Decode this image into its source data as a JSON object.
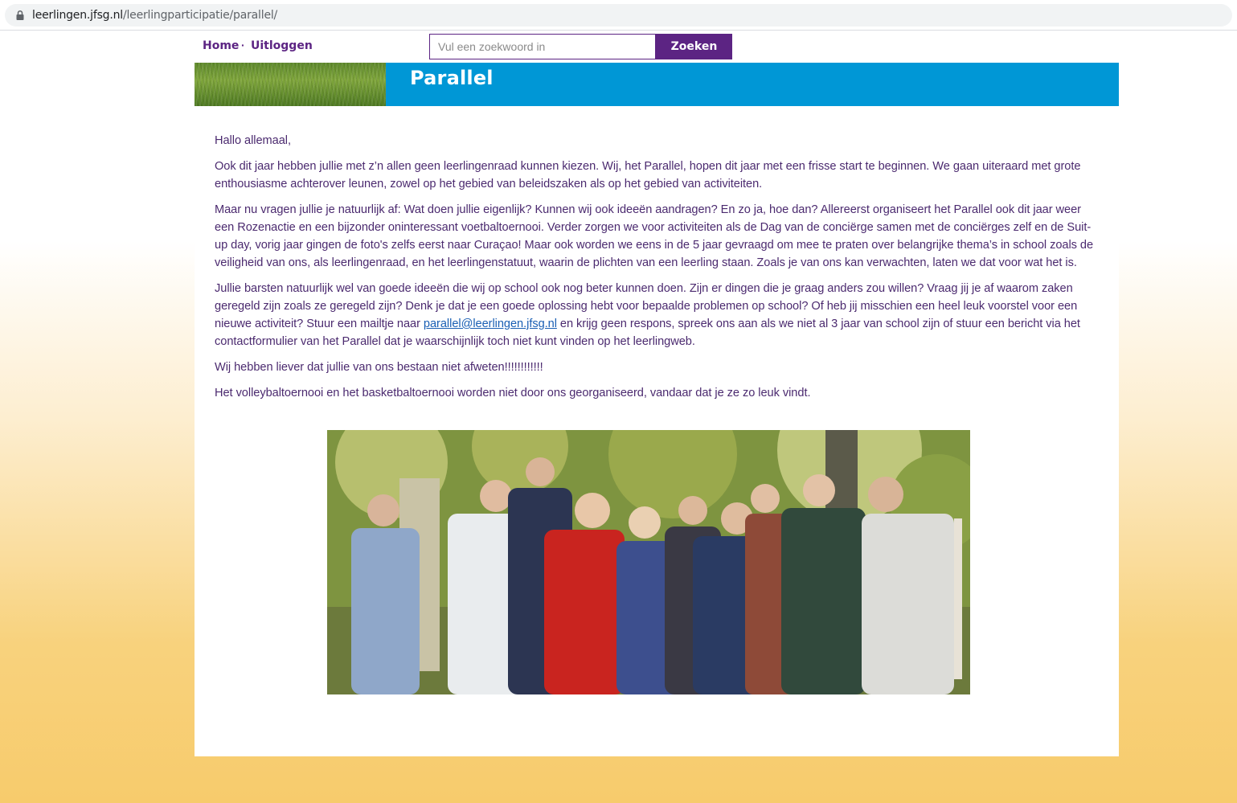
{
  "browser": {
    "url_host": "leerlingen.jfsg.nl",
    "url_path": "/leerlingparticipatie/parallel/"
  },
  "nav": {
    "home_label": "Home",
    "separator": "·",
    "logout_label": "Uitloggen"
  },
  "search": {
    "placeholder": "Vul een zoekwoord in",
    "button_label": "Zoeken"
  },
  "banner": {
    "title": "Parallel"
  },
  "article": {
    "greeting": "Hallo allemaal,",
    "p1": "Ook dit jaar hebben jullie met z’n allen geen leerlingenraad kunnen kiezen. Wij, het Parallel, hopen dit jaar met een frisse start te beginnen. We gaan uiteraard met grote enthousiasme achterover leunen, zowel op het gebied van beleidszaken als op het gebied van activiteiten.",
    "p2": "Maar nu vragen jullie je natuurlijk af: Wat doen jullie eigenlijk? Kunnen wij ook ideeën aandragen? En zo ja, hoe dan? Allereerst organiseert het Parallel ook dit jaar weer een Rozenactie en een bijzonder oninteressant voetbaltoernooi. Verder zorgen we voor activiteiten als de Dag van de conciërge samen met de conciërges zelf en de Suit-up day, vorig jaar gingen de foto's zelfs eerst naar Curaçao! Maar ook worden we eens in de 5 jaar gevraagd om mee te praten over belangrijke thema’s in school zoals de veiligheid van ons, als leerlingenraad, en het leerlingenstatuut, waarin de plichten van een leerling staan. Zoals je van ons kan verwachten, laten we dat voor wat het is.",
    "p3_before": "Jullie barsten natuurlijk wel van goede ideeën die wij op school ook nog beter kunnen doen. Zijn er dingen die je graag anders zou willen? Vraag jij je af waarom zaken geregeld zijn zoals ze geregeld zijn? Denk je dat je een goede oplossing hebt voor bepaalde problemen op school? Of heb jij misschien een heel leuk voorstel voor een nieuwe activiteit? Stuur een mailtje naar ",
    "p3_email": "parallel@leerlingen.jfsg.nl",
    "p3_after": " en krijg geen respons, spreek ons aan als we niet al 3 jaar van school zijn of stuur een bericht via het contactformulier van het Parallel dat je waarschijnlijk toch niet kunt vinden op het leerlingweb.",
    "p4": "Wij hebben liever dat jullie van ons bestaan niet afweten!!!!!!!!!!!!",
    "p5": "Het volleybaltoernooi en het basketbaltoernooi worden niet door ons georganiseerd, vandaar dat je ze zo leuk vindt."
  },
  "colors": {
    "brand_purple": "#5c2483",
    "banner_blue": "#0097d6",
    "body_text": "#4b2a6f",
    "link": "#1a5fb4"
  },
  "icons": {
    "lock": "lock-icon"
  }
}
